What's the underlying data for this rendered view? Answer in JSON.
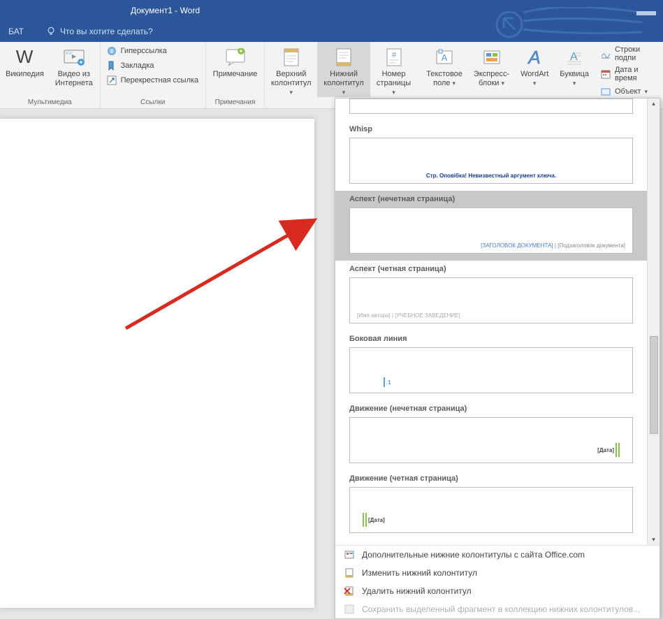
{
  "titlebar": {
    "title": "Документ1 - Word"
  },
  "tabs": {
    "bat": "БАТ",
    "tellme": "Что вы хотите сделать?"
  },
  "ribbon": {
    "wikipedia": "Википедия",
    "video_line1": "Видео из",
    "video_line2": "Интернета",
    "group_media": "Мультимедиа",
    "hyperlink": "Гиперссылка",
    "bookmark": "Закладка",
    "crossref": "Перекрестная ссылка",
    "group_links": "Ссылки",
    "comment": "Примечание",
    "group_comments": "Примечания",
    "header_line1": "Верхний",
    "header_line2": "колонтитул",
    "footer_line1": "Нижний",
    "footer_line2": "колонтитул",
    "pagenum_line1": "Номер",
    "pagenum_line2": "страницы",
    "textbox_line1": "Текстовое",
    "textbox_line2": "поле",
    "express_line1": "Экспресс-",
    "express_line2": "блоки",
    "wordart": "WordArt",
    "dropcap": "Буквица",
    "sigline": "Строки подпи",
    "datetime": "Дата и время",
    "object": "Объект"
  },
  "dropdown": {
    "items": [
      {
        "label": "Whisp",
        "type": "whisp",
        "content": "Стр. Оповібка! Невизвестный аргумент ключа."
      },
      {
        "label": "Аспект (нечетная страница)",
        "type": "aspect-odd",
        "blue": "[ЗАГОЛОВОК ДОКУМЕНТА]",
        "grey": "| [Подзаголовок документа]",
        "selected": true
      },
      {
        "label": "Аспект (четная страница)",
        "type": "aspect-even",
        "content": "[Имя автора] | [УЧЕБНОЕ ЗАВЕДЕНИЕ]"
      },
      {
        "label": "Боковая линия",
        "type": "side",
        "num": "1"
      },
      {
        "label": "Движение (нечетная страница)",
        "type": "motion-odd",
        "date": "[Дата]"
      },
      {
        "label": "Движение (четная страница)",
        "type": "motion-even",
        "date": "[Дата]"
      }
    ],
    "menu": {
      "more": "Дополнительные нижние колонтитулы с сайта Office.com",
      "edit": "Изменить нижний колонтитул",
      "remove": "Удалить нижний колонтитул",
      "save": "Сохранить выделенный фрагмент в коллекцию нижних колонтитулов..."
    }
  }
}
